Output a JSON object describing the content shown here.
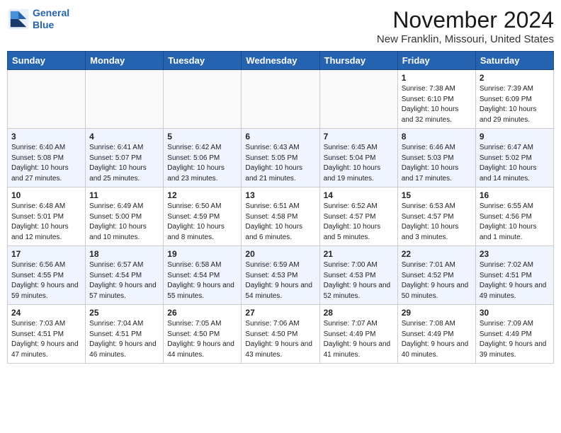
{
  "logo": {
    "line1": "General",
    "line2": "Blue"
  },
  "title": "November 2024",
  "location": "New Franklin, Missouri, United States",
  "days_of_week": [
    "Sunday",
    "Monday",
    "Tuesday",
    "Wednesday",
    "Thursday",
    "Friday",
    "Saturday"
  ],
  "weeks": [
    [
      {
        "day": "",
        "empty": true
      },
      {
        "day": "",
        "empty": true
      },
      {
        "day": "",
        "empty": true
      },
      {
        "day": "",
        "empty": true
      },
      {
        "day": "",
        "empty": true
      },
      {
        "day": "1",
        "sunrise": "7:38 AM",
        "sunset": "6:10 PM",
        "daylight": "10 hours and 32 minutes."
      },
      {
        "day": "2",
        "sunrise": "7:39 AM",
        "sunset": "6:09 PM",
        "daylight": "10 hours and 29 minutes."
      }
    ],
    [
      {
        "day": "3",
        "sunrise": "6:40 AM",
        "sunset": "5:08 PM",
        "daylight": "10 hours and 27 minutes."
      },
      {
        "day": "4",
        "sunrise": "6:41 AM",
        "sunset": "5:07 PM",
        "daylight": "10 hours and 25 minutes."
      },
      {
        "day": "5",
        "sunrise": "6:42 AM",
        "sunset": "5:06 PM",
        "daylight": "10 hours and 23 minutes."
      },
      {
        "day": "6",
        "sunrise": "6:43 AM",
        "sunset": "5:05 PM",
        "daylight": "10 hours and 21 minutes."
      },
      {
        "day": "7",
        "sunrise": "6:45 AM",
        "sunset": "5:04 PM",
        "daylight": "10 hours and 19 minutes."
      },
      {
        "day": "8",
        "sunrise": "6:46 AM",
        "sunset": "5:03 PM",
        "daylight": "10 hours and 17 minutes."
      },
      {
        "day": "9",
        "sunrise": "6:47 AM",
        "sunset": "5:02 PM",
        "daylight": "10 hours and 14 minutes."
      }
    ],
    [
      {
        "day": "10",
        "sunrise": "6:48 AM",
        "sunset": "5:01 PM",
        "daylight": "10 hours and 12 minutes."
      },
      {
        "day": "11",
        "sunrise": "6:49 AM",
        "sunset": "5:00 PM",
        "daylight": "10 hours and 10 minutes."
      },
      {
        "day": "12",
        "sunrise": "6:50 AM",
        "sunset": "4:59 PM",
        "daylight": "10 hours and 8 minutes."
      },
      {
        "day": "13",
        "sunrise": "6:51 AM",
        "sunset": "4:58 PM",
        "daylight": "10 hours and 6 minutes."
      },
      {
        "day": "14",
        "sunrise": "6:52 AM",
        "sunset": "4:57 PM",
        "daylight": "10 hours and 5 minutes."
      },
      {
        "day": "15",
        "sunrise": "6:53 AM",
        "sunset": "4:57 PM",
        "daylight": "10 hours and 3 minutes."
      },
      {
        "day": "16",
        "sunrise": "6:55 AM",
        "sunset": "4:56 PM",
        "daylight": "10 hours and 1 minute."
      }
    ],
    [
      {
        "day": "17",
        "sunrise": "6:56 AM",
        "sunset": "4:55 PM",
        "daylight": "9 hours and 59 minutes."
      },
      {
        "day": "18",
        "sunrise": "6:57 AM",
        "sunset": "4:54 PM",
        "daylight": "9 hours and 57 minutes."
      },
      {
        "day": "19",
        "sunrise": "6:58 AM",
        "sunset": "4:54 PM",
        "daylight": "9 hours and 55 minutes."
      },
      {
        "day": "20",
        "sunrise": "6:59 AM",
        "sunset": "4:53 PM",
        "daylight": "9 hours and 54 minutes."
      },
      {
        "day": "21",
        "sunrise": "7:00 AM",
        "sunset": "4:53 PM",
        "daylight": "9 hours and 52 minutes."
      },
      {
        "day": "22",
        "sunrise": "7:01 AM",
        "sunset": "4:52 PM",
        "daylight": "9 hours and 50 minutes."
      },
      {
        "day": "23",
        "sunrise": "7:02 AM",
        "sunset": "4:51 PM",
        "daylight": "9 hours and 49 minutes."
      }
    ],
    [
      {
        "day": "24",
        "sunrise": "7:03 AM",
        "sunset": "4:51 PM",
        "daylight": "9 hours and 47 minutes."
      },
      {
        "day": "25",
        "sunrise": "7:04 AM",
        "sunset": "4:51 PM",
        "daylight": "9 hours and 46 minutes."
      },
      {
        "day": "26",
        "sunrise": "7:05 AM",
        "sunset": "4:50 PM",
        "daylight": "9 hours and 44 minutes."
      },
      {
        "day": "27",
        "sunrise": "7:06 AM",
        "sunset": "4:50 PM",
        "daylight": "9 hours and 43 minutes."
      },
      {
        "day": "28",
        "sunrise": "7:07 AM",
        "sunset": "4:49 PM",
        "daylight": "9 hours and 41 minutes."
      },
      {
        "day": "29",
        "sunrise": "7:08 AM",
        "sunset": "4:49 PM",
        "daylight": "9 hours and 40 minutes."
      },
      {
        "day": "30",
        "sunrise": "7:09 AM",
        "sunset": "4:49 PM",
        "daylight": "9 hours and 39 minutes."
      }
    ]
  ]
}
